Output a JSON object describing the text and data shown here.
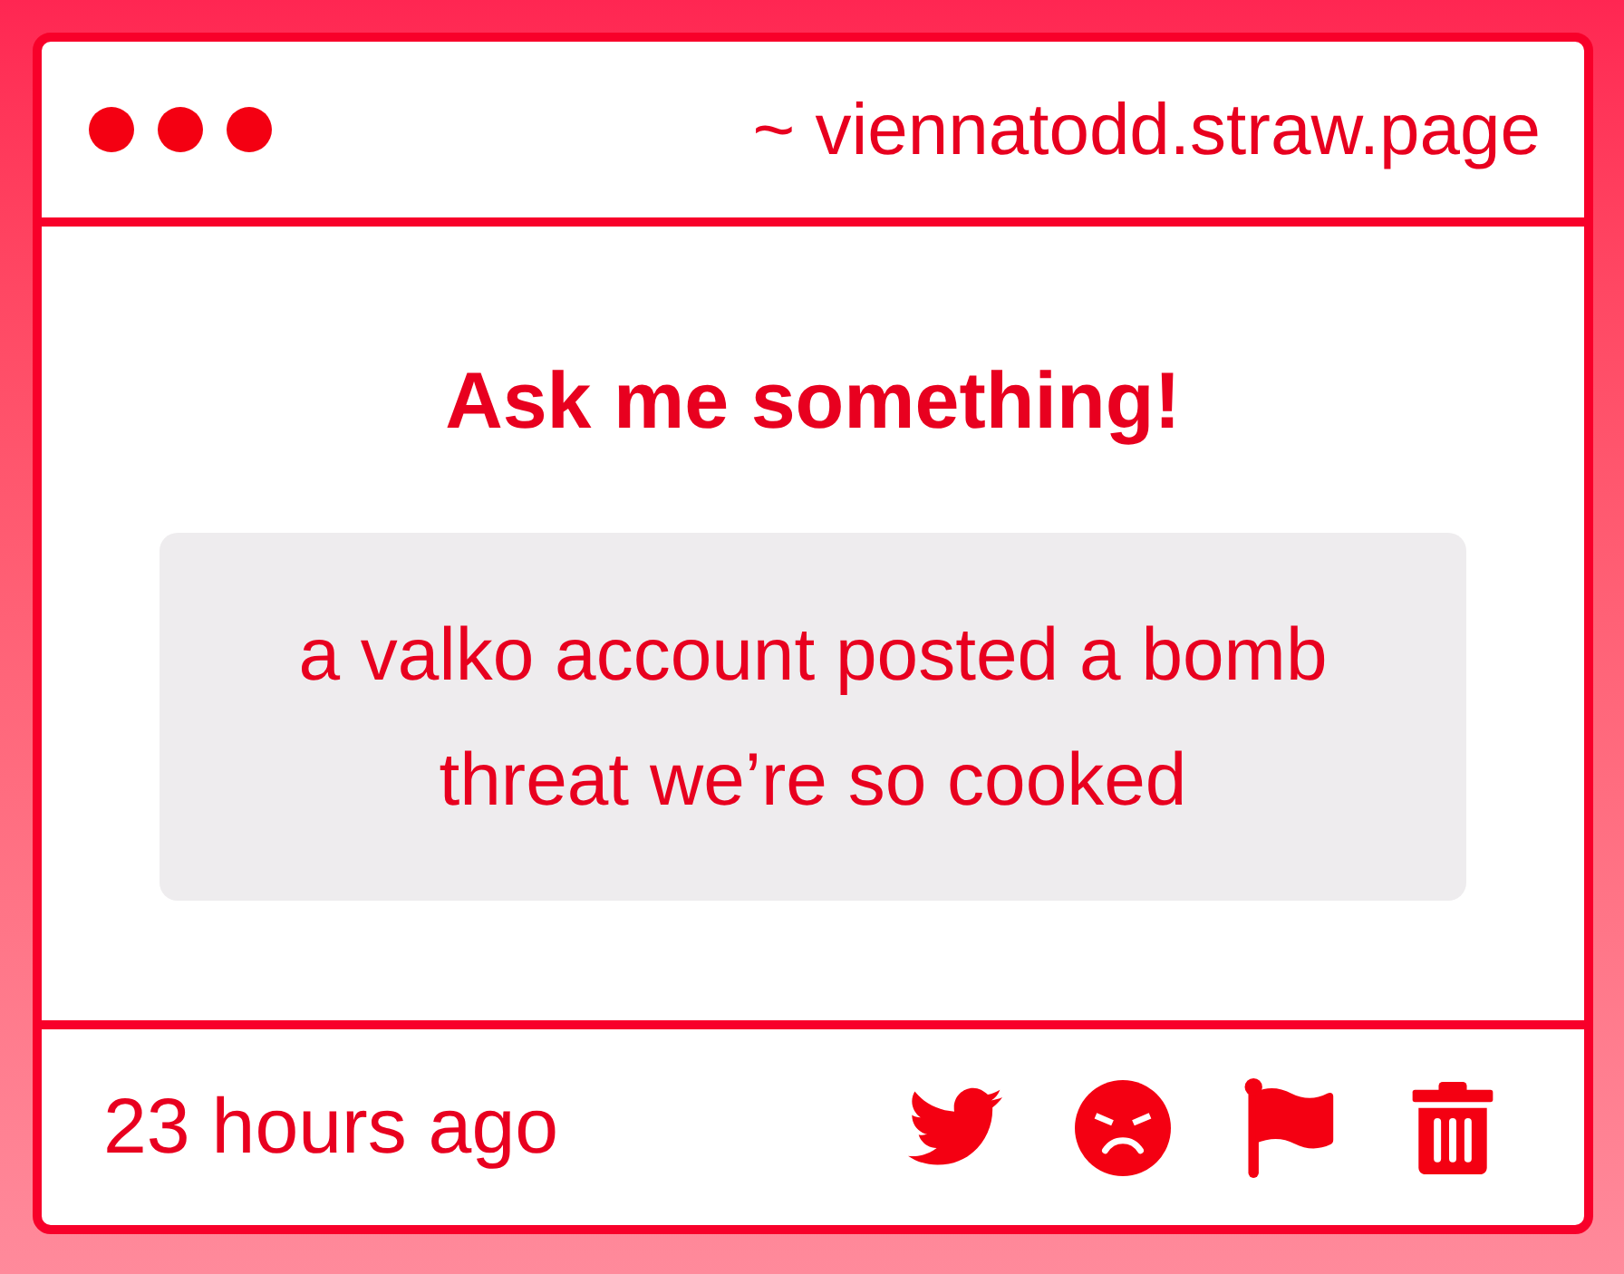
{
  "window": {
    "address": "~ viennatodd.straw.page"
  },
  "heading": "Ask me something!",
  "question": "a valko account posted a bomb threat we’re so cooked",
  "footer": {
    "time": "23 hours ago",
    "actions": [
      {
        "kind": "tweet"
      },
      {
        "kind": "block"
      },
      {
        "kind": "report"
      },
      {
        "kind": "delete"
      }
    ]
  }
}
